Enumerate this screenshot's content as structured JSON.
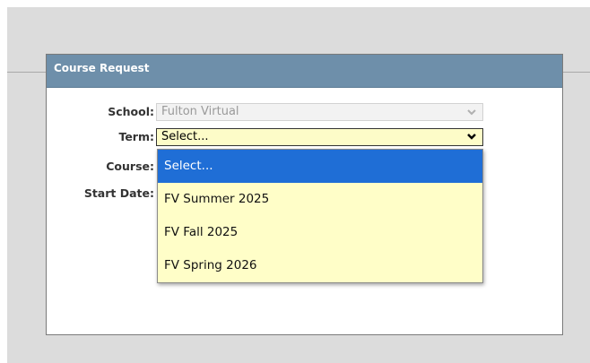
{
  "panel": {
    "title": "Course Request"
  },
  "form": {
    "school_label": "School:",
    "school_value": "Fulton Virtual",
    "term_label": "Term:",
    "term_value": "Select...",
    "course_label": "Course:",
    "start_date_label": "Start Date:"
  },
  "term_dropdown": {
    "options": [
      "Select...",
      "FV Summer 2025",
      "FV Fall 2025",
      "FV Spring 2026"
    ],
    "highlighted_index": 0
  },
  "colors": {
    "header_bg": "#6e8faa",
    "select_bg": "#fdfcc8",
    "highlight": "#1f6ed6"
  }
}
